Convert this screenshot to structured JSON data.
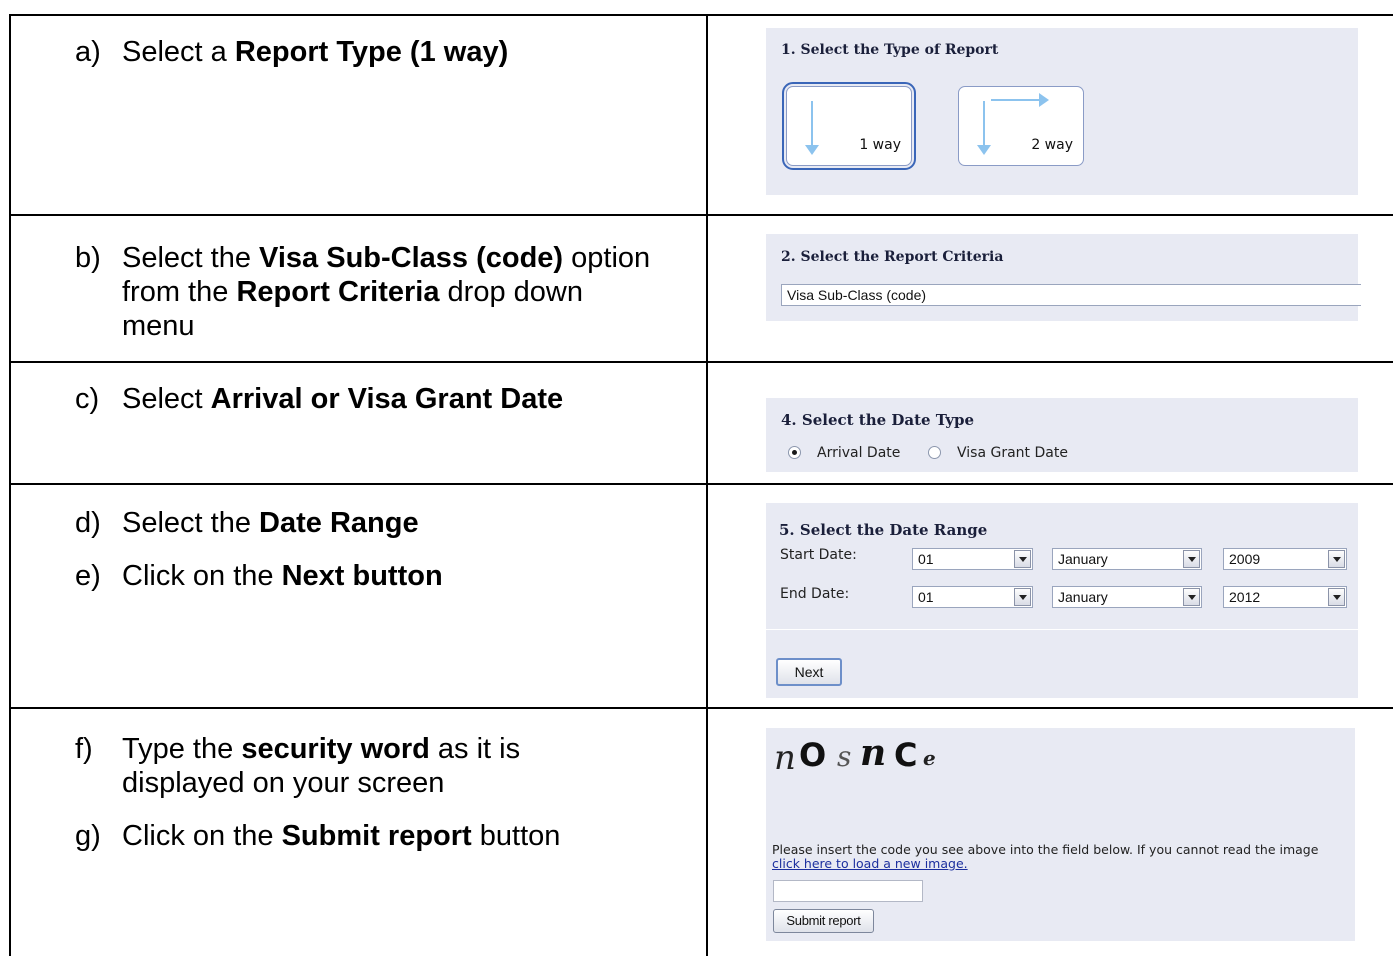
{
  "rows": [
    {
      "id": "a",
      "label": "a)",
      "parts": [
        {
          "t": "Select a ",
          "b": false
        },
        {
          "t": "Report Type (1 way)",
          "b": true
        }
      ]
    },
    {
      "id": "b",
      "label": "b)",
      "parts": [
        {
          "t": "Select the ",
          "b": false
        },
        {
          "t": "Visa Sub-Class (code)",
          "b": true
        },
        {
          "t": " option from the ",
          "b": false
        },
        {
          "t": "Report Criteria",
          "b": true
        },
        {
          "t": " drop down menu",
          "b": false
        }
      ]
    },
    {
      "id": "c",
      "label": "c)",
      "parts": [
        {
          "t": "Select ",
          "b": false
        },
        {
          "t": "Arrival or Visa Grant Date",
          "b": true
        }
      ]
    },
    {
      "id": "d",
      "label": "d)",
      "parts": [
        {
          "t": "Select the ",
          "b": false
        },
        {
          "t": "Date Range",
          "b": true
        }
      ]
    },
    {
      "id": "e",
      "label": "e)",
      "parts": [
        {
          "t": "Click on the ",
          "b": false
        },
        {
          "t": "Next button",
          "b": true
        }
      ]
    },
    {
      "id": "f",
      "label": "f)",
      "parts": [
        {
          "t": "Type the ",
          "b": false
        },
        {
          "t": "security word",
          "b": true
        },
        {
          "t": " as it is displayed on your screen",
          "b": false
        }
      ]
    },
    {
      "id": "g",
      "label": "g)",
      "parts": [
        {
          "t": "Click on the ",
          "b": false
        },
        {
          "t": "Submit report",
          "b": true
        },
        {
          "t": " button",
          "b": false
        }
      ]
    }
  ],
  "report_type": {
    "title": "1. Select the Type of Report",
    "options": [
      "1 way",
      "2 way"
    ],
    "selected": "1 way"
  },
  "criteria": {
    "title": "2. Select the Report Criteria",
    "value": "Visa Sub-Class (code)"
  },
  "date_type": {
    "title": "4. Select the Date Type",
    "options": [
      "Arrival Date",
      "Visa Grant Date"
    ],
    "selected": "Arrival Date"
  },
  "date_range": {
    "title": "5. Select the Date Range",
    "start_label": "Start Date:",
    "end_label": "End Date:",
    "start": {
      "day": "01",
      "month": "January",
      "year": "2009"
    },
    "end": {
      "day": "01",
      "month": "January",
      "year": "2012"
    },
    "next_label": "Next"
  },
  "captcha": {
    "glyphs": [
      "n",
      "O",
      "s",
      "n",
      "C",
      "e"
    ],
    "instruction": "Please insert the code you see above into the field below. If you cannot read the image",
    "link_text": "click here to load a new image.",
    "input_value": "",
    "submit_label": "Submit report"
  }
}
